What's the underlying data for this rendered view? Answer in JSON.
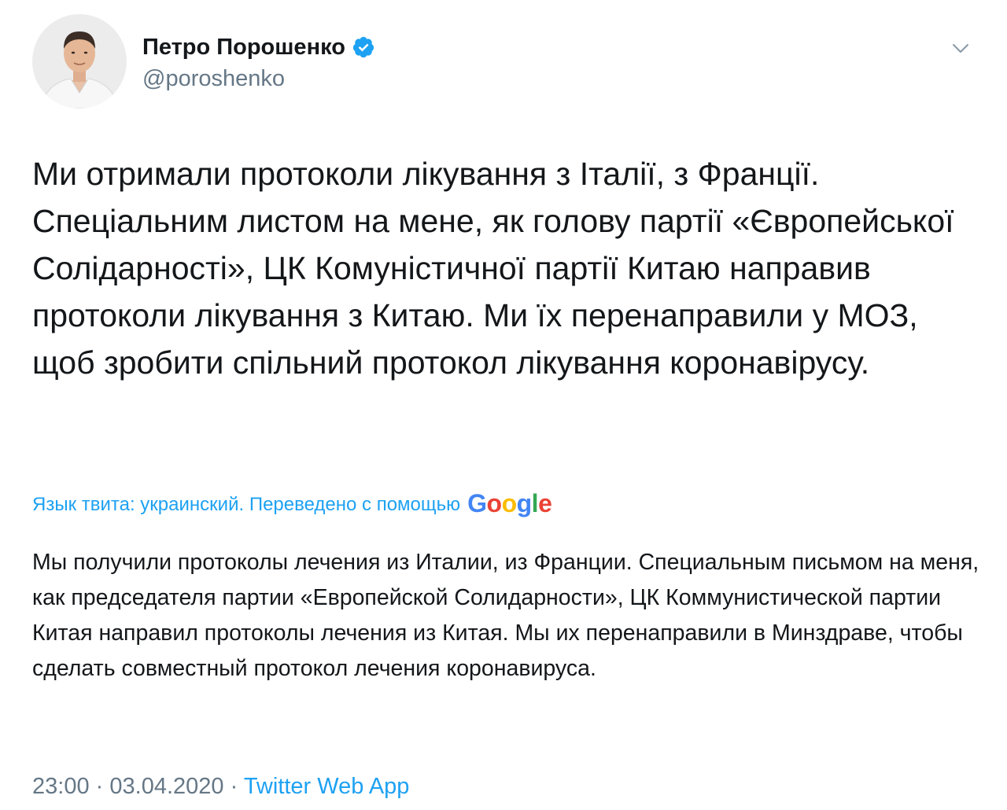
{
  "author": {
    "display_name": "Петро Порошенко",
    "handle": "@poroshenko",
    "verified_icon": "verified-badge-icon",
    "avatar_icon": "avatar"
  },
  "menu": {
    "icon": "chevron-down-icon"
  },
  "tweet": {
    "text": "Ми отримали протоколи лікування з Італії, з Франції. Спеціальним листом на мене, як голову партії «Європейської Солідарності», ЦК Комуністичної партії Китаю направив протоколи лікування з Китаю. Ми їх перенаправили у МОЗ, щоб зробити спільний протокол лікування коронавірусу."
  },
  "translation": {
    "label": "Язык твита: украинский. Переведено с помощью",
    "provider_letters": [
      "G",
      "o",
      "o",
      "g",
      "l",
      "e"
    ],
    "text": "Мы получили протоколы лечения из Италии, из Франции. Специальным письмом на меня, как председателя партии «Европейской Солидарности», ЦК Коммунистической партии Китая направил протоколы лечения из Китая. Мы их перенаправили в Минздраве, чтобы сделать совместный протокол лечения коронавируса."
  },
  "meta": {
    "time": "23:00",
    "separator": "·",
    "date": "03.04.2020",
    "source": "Twitter Web App"
  },
  "colors": {
    "link": "#1da1f2",
    "secondary_text": "#657786",
    "primary_text": "#14171a",
    "google_blue": "#4285f4",
    "google_red": "#ea4335",
    "google_yellow": "#fbbc05",
    "google_green": "#34a853"
  }
}
